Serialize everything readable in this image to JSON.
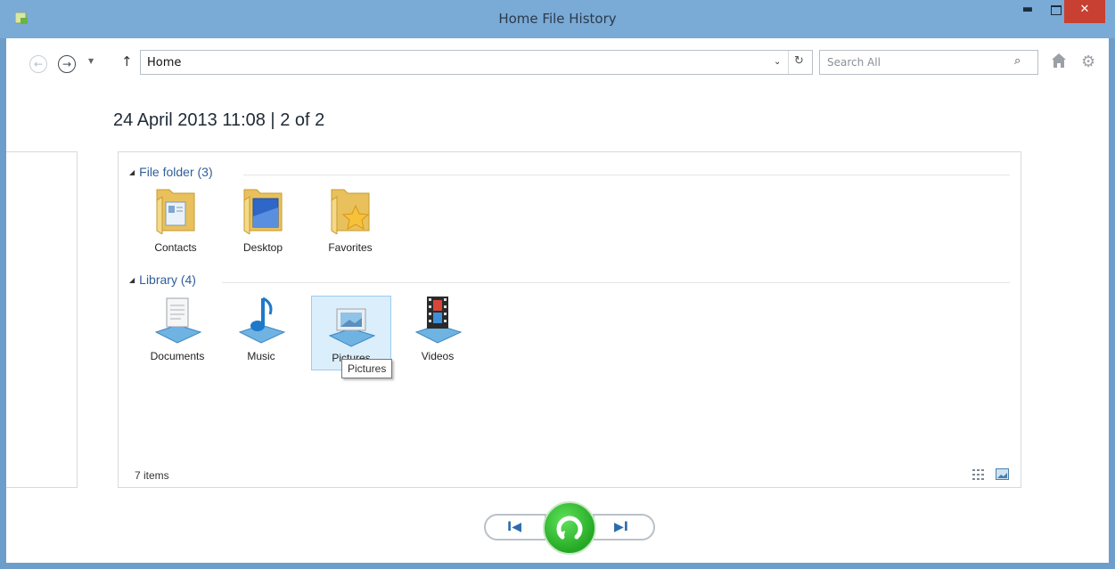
{
  "window": {
    "title": "Home   File History"
  },
  "toolbar": {
    "address": "Home",
    "search_placeholder": "Search All"
  },
  "snapshot": {
    "date_text": "24 April 2013 11:08   |   2 of 2"
  },
  "groups": [
    {
      "label": "File folder (3)",
      "items": [
        "Contacts",
        "Desktop",
        "Favorites"
      ]
    },
    {
      "label": "Library (4)",
      "items": [
        "Documents",
        "Music",
        "Pictures",
        "Videos"
      ]
    }
  ],
  "selected_item": "Pictures",
  "tooltip": "Pictures",
  "status": {
    "count": "7 items"
  },
  "colors": {
    "titlebar": "#7aaad6",
    "close": "#c84031",
    "group_header": "#2f5e9a",
    "restore": "#25a824"
  }
}
